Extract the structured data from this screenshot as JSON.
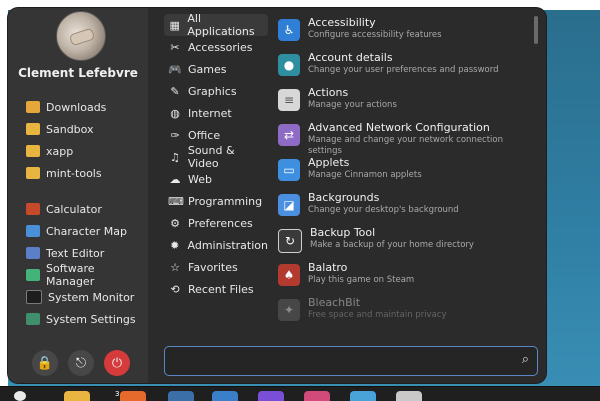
{
  "user": {
    "name": "Clement Lefebvre"
  },
  "places": [
    {
      "label": "Downloads",
      "icon": "downloads-folder-icon"
    },
    {
      "label": "Sandbox",
      "icon": "folder-icon"
    },
    {
      "label": "xapp",
      "icon": "folder-icon"
    },
    {
      "label": "mint-tools",
      "icon": "folder-icon"
    }
  ],
  "favorites": [
    {
      "label": "Calculator",
      "icon": "calculator-icon"
    },
    {
      "label": "Character Map",
      "icon": "character-map-icon"
    },
    {
      "label": "Text Editor",
      "icon": "text-editor-icon"
    },
    {
      "label": "Software Manager",
      "icon": "software-manager-icon"
    },
    {
      "label": "System Monitor",
      "icon": "system-monitor-icon"
    },
    {
      "label": "System Settings",
      "icon": "system-settings-icon"
    }
  ],
  "power_buttons": [
    {
      "icon": "lock-icon",
      "glyph": "🔒"
    },
    {
      "icon": "logout-icon",
      "glyph": "⎋"
    },
    {
      "icon": "power-icon",
      "glyph": "⏻"
    }
  ],
  "categories": [
    {
      "label": "All Applications",
      "glyph": "▦",
      "icon": "grid-icon",
      "active": true
    },
    {
      "label": "Accessories",
      "glyph": "✂",
      "icon": "accessories-icon"
    },
    {
      "label": "Games",
      "glyph": "🎮",
      "icon": "games-icon"
    },
    {
      "label": "Graphics",
      "glyph": "✎",
      "icon": "graphics-icon"
    },
    {
      "label": "Internet",
      "glyph": "◍",
      "icon": "internet-icon"
    },
    {
      "label": "Office",
      "glyph": "✑",
      "icon": "office-icon"
    },
    {
      "label": "Sound & Video",
      "glyph": "♫",
      "icon": "sound-video-icon"
    },
    {
      "label": "Web",
      "glyph": "☁",
      "icon": "web-icon"
    },
    {
      "label": "Programming",
      "glyph": "⌨",
      "icon": "programming-icon"
    },
    {
      "label": "Preferences",
      "glyph": "⚙",
      "icon": "preferences-icon"
    },
    {
      "label": "Administration",
      "glyph": "✹",
      "icon": "administration-icon"
    },
    {
      "label": "Favorites",
      "glyph": "☆",
      "icon": "favorites-icon"
    },
    {
      "label": "Recent Files",
      "glyph": "⟲",
      "icon": "recent-files-icon"
    }
  ],
  "apps": [
    {
      "name": "Accessibility",
      "desc": "Configure accessibility features",
      "icon": "accessibility-icon",
      "color": "#2f7fd6",
      "glyph": "♿"
    },
    {
      "name": "Account details",
      "desc": "Change your user preferences and password",
      "icon": "account-icon",
      "color": "#2d8fa0",
      "glyph": "●"
    },
    {
      "name": "Actions",
      "desc": "Manage your actions",
      "icon": "actions-icon",
      "color": "#d7d7d7",
      "glyph": "≡"
    },
    {
      "name": "Advanced Network Configuration",
      "desc": "Manage and change your network connection settings",
      "icon": "network-icon",
      "color": "#8e6bc4",
      "glyph": "⇄"
    },
    {
      "name": "Applets",
      "desc": "Manage Cinnamon applets",
      "icon": "applets-icon",
      "color": "#3f8fe0",
      "glyph": "▭"
    },
    {
      "name": "Backgrounds",
      "desc": "Change your desktop's background",
      "icon": "backgrounds-icon",
      "color": "#4a8fe0",
      "glyph": "◪"
    },
    {
      "name": "Backup Tool",
      "desc": "Make a backup of your home directory",
      "icon": "backup-icon",
      "color": "#3a3a3a",
      "glyph": "↻"
    },
    {
      "name": "Balatro",
      "desc": "Play this game on Steam",
      "icon": "balatro-icon",
      "color": "#b23a2e",
      "glyph": "♠"
    },
    {
      "name": "BleachBit",
      "desc": "Free space and maintain privacy",
      "icon": "bleachbit-icon",
      "color": "#6a6a6a",
      "glyph": "✦",
      "faded": true
    }
  ],
  "search": {
    "value": "",
    "icon": "search-icon"
  },
  "taskbar": {
    "badge": "3",
    "items": [
      {
        "icon": "taskbar-files-icon",
        "color": "#e8b640"
      },
      {
        "icon": "taskbar-firefox-icon",
        "color": "#e66a2c"
      },
      {
        "icon": "taskbar-terminal-icon",
        "color": "#3a6fa8"
      },
      {
        "icon": "taskbar-app-icon",
        "color": "#7a4fd8"
      },
      {
        "icon": "taskbar-app2-icon",
        "color": "#d14a7a"
      },
      {
        "icon": "taskbar-app3-icon",
        "color": "#4aa3d8"
      },
      {
        "icon": "taskbar-app4-icon",
        "color": "#3aa35a"
      },
      {
        "icon": "taskbar-app5-icon",
        "color": "#c9c9c9"
      }
    ]
  }
}
